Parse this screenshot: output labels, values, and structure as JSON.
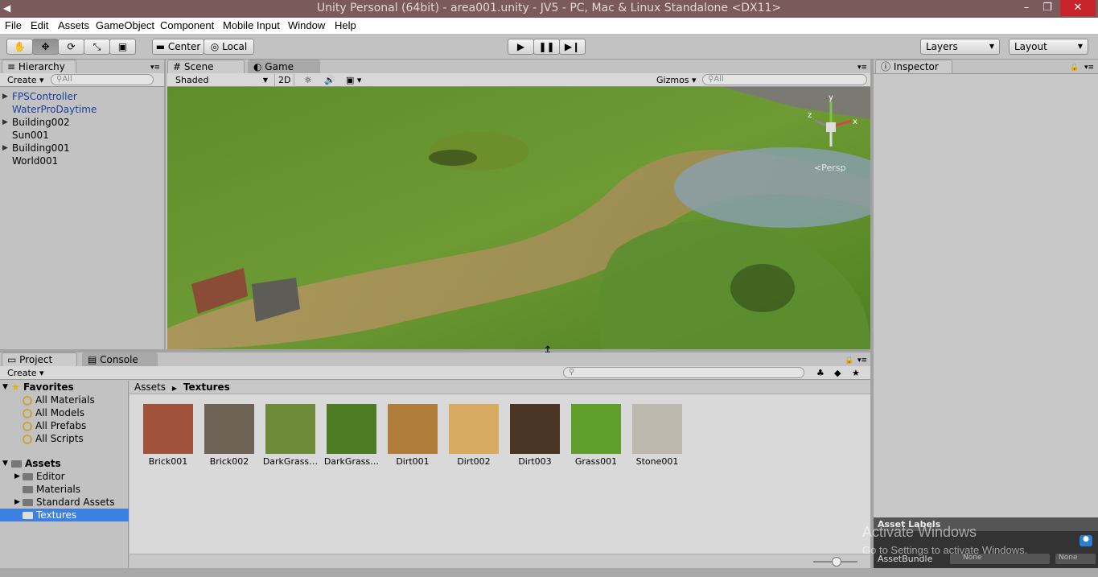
{
  "window": {
    "title": "Unity Personal (64bit) - area001.unity - JV5 - PC, Mac & Linux Standalone <DX11>",
    "min": "–",
    "max": "❐",
    "close": "✕"
  },
  "menu": [
    "File",
    "Edit",
    "Assets",
    "GameObject",
    "Component",
    "Mobile Input",
    "Window",
    "Help"
  ],
  "toolbar": {
    "pivot": "Center",
    "space": "Local",
    "layers": "Layers",
    "layout": "Layout"
  },
  "hierarchy": {
    "tab": "Hierarchy",
    "create": "Create",
    "search_placeholder": "All",
    "items": [
      {
        "label": "FPSController",
        "blue": true,
        "expand": true
      },
      {
        "label": "WaterProDaytime",
        "blue": true,
        "expand": false
      },
      {
        "label": "Building002",
        "blue": false,
        "expand": true
      },
      {
        "label": "Sun001",
        "blue": false,
        "expand": false
      },
      {
        "label": "Building001",
        "blue": false,
        "expand": true
      },
      {
        "label": "World001",
        "blue": false,
        "expand": false
      }
    ]
  },
  "scene": {
    "tab_scene": "Scene",
    "tab_game": "Game",
    "shading": "Shaded",
    "mode_2d": "2D",
    "gizmos": "Gizmos",
    "search_placeholder": "All",
    "persp": "Persp",
    "axis_y": "y",
    "axis_x": "x",
    "axis_z": "z"
  },
  "inspector": {
    "tab": "Inspector",
    "asset_labels": "Asset Labels",
    "asset_bundle": "AssetBundle",
    "none1": "None",
    "none2": "None"
  },
  "project": {
    "tab_project": "Project",
    "tab_console": "Console",
    "create": "Create",
    "favorites_label": "Favorites",
    "favorites": [
      "All Materials",
      "All Models",
      "All Prefabs",
      "All Scripts"
    ],
    "assets_label": "Assets",
    "folders": [
      {
        "label": "Editor",
        "expand": true,
        "selected": false
      },
      {
        "label": "Materials",
        "expand": false,
        "selected": false
      },
      {
        "label": "Standard Assets",
        "expand": true,
        "selected": false
      },
      {
        "label": "Textures",
        "expand": false,
        "selected": true
      }
    ],
    "breadcrumb_root": "Assets",
    "breadcrumb_current": "Textures",
    "textures": [
      {
        "label": "Brick001",
        "color": "#a0533a"
      },
      {
        "label": "Brick002",
        "color": "#6e6354"
      },
      {
        "label": "DarkGrass…",
        "color": "#6c8a3a"
      },
      {
        "label": "DarkGrass…",
        "color": "#4d7a24"
      },
      {
        "label": "Dirt001",
        "color": "#b07e3a"
      },
      {
        "label": "Dirt002",
        "color": "#d8ab62"
      },
      {
        "label": "Dirt003",
        "color": "#4a3424"
      },
      {
        "label": "Grass001",
        "color": "#5f9e2a"
      },
      {
        "label": "Stone001",
        "color": "#bdb9ae"
      }
    ]
  },
  "watermark": {
    "line1": "Activate Windows",
    "line2": "Go to Settings to activate Windows."
  }
}
